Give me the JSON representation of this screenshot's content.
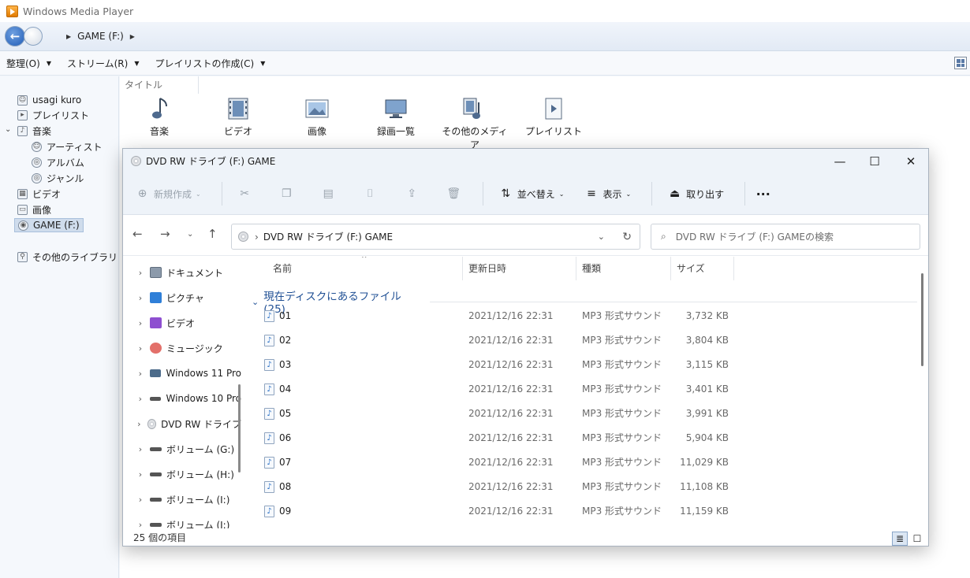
{
  "wmp": {
    "title": "Windows Media Player",
    "breadcrumb": "GAME (F:)",
    "menu": [
      {
        "label": "整理(O)"
      },
      {
        "label": "ストリーム(R)"
      },
      {
        "label": "プレイリストの作成(C)"
      }
    ],
    "sidebar": {
      "user": "usagi kuro",
      "playlist": "プレイリスト",
      "music": "音楽",
      "artist": "アーティスト",
      "album": "アルバム",
      "genre": "ジャンル",
      "video": "ビデオ",
      "picture": "画像",
      "game": "GAME (F:)",
      "other_libraries": "その他のライブラリ"
    },
    "column_header": "タイトル",
    "library_tiles": [
      {
        "label": "音楽",
        "icon": "music-note-icon"
      },
      {
        "label": "ビデオ",
        "icon": "film-icon"
      },
      {
        "label": "画像",
        "icon": "picture-icon"
      },
      {
        "label": "録画一覧",
        "icon": "monitor-icon"
      },
      {
        "label": "その他のメディア",
        "icon": "other-media-icon"
      },
      {
        "label": "プレイリスト",
        "icon": "playlist-icon"
      }
    ]
  },
  "explorer": {
    "title": "DVD RW ドライブ (F:) GAME",
    "toolbar": {
      "new": "新規作成",
      "sort": "並べ替え",
      "view": "表示",
      "eject": "取り出す"
    },
    "address": "DVD RW ドライブ (F:) GAME",
    "search_placeholder": "DVD RW ドライブ (F:) GAMEの検索",
    "nav": [
      {
        "label": "ドキュメント",
        "icon": "documents-icon"
      },
      {
        "label": "ピクチャ",
        "icon": "pictures-icon"
      },
      {
        "label": "ビデオ",
        "icon": "videos-icon"
      },
      {
        "label": "ミュージック",
        "icon": "music-icon"
      },
      {
        "label": "Windows 11 Pro",
        "icon": "drive-icon"
      },
      {
        "label": "Windows 10 Pro",
        "icon": "drive-icon"
      },
      {
        "label": "DVD RW ドライブ",
        "icon": "dvd-icon"
      },
      {
        "label": "ボリューム (G:)",
        "icon": "drive-icon"
      },
      {
        "label": "ボリューム (H:)",
        "icon": "drive-icon"
      },
      {
        "label": "ボリューム (I:)",
        "icon": "drive-icon"
      },
      {
        "label": "ボリューム (J:)",
        "icon": "drive-icon"
      }
    ],
    "columns": {
      "name": "名前",
      "date": "更新日時",
      "type": "種類",
      "size": "サイズ"
    },
    "group_label": "現在ディスクにあるファイル (25)",
    "files": [
      {
        "name": "01",
        "date": "2021/12/16 22:31",
        "type": "MP3 形式サウンド",
        "size": "3,732 KB"
      },
      {
        "name": "02",
        "date": "2021/12/16 22:31",
        "type": "MP3 形式サウンド",
        "size": "3,804 KB"
      },
      {
        "name": "03",
        "date": "2021/12/16 22:31",
        "type": "MP3 形式サウンド",
        "size": "3,115 KB"
      },
      {
        "name": "04",
        "date": "2021/12/16 22:31",
        "type": "MP3 形式サウンド",
        "size": "3,401 KB"
      },
      {
        "name": "05",
        "date": "2021/12/16 22:31",
        "type": "MP3 形式サウンド",
        "size": "3,991 KB"
      },
      {
        "name": "06",
        "date": "2021/12/16 22:31",
        "type": "MP3 形式サウンド",
        "size": "5,904 KB"
      },
      {
        "name": "07",
        "date": "2021/12/16 22:31",
        "type": "MP3 形式サウンド",
        "size": "11,029 KB"
      },
      {
        "name": "08",
        "date": "2021/12/16 22:31",
        "type": "MP3 形式サウンド",
        "size": "11,108 KB"
      },
      {
        "name": "09",
        "date": "2021/12/16 22:31",
        "type": "MP3 形式サウンド",
        "size": "11,159 KB"
      }
    ],
    "status": "25 個の項目"
  }
}
